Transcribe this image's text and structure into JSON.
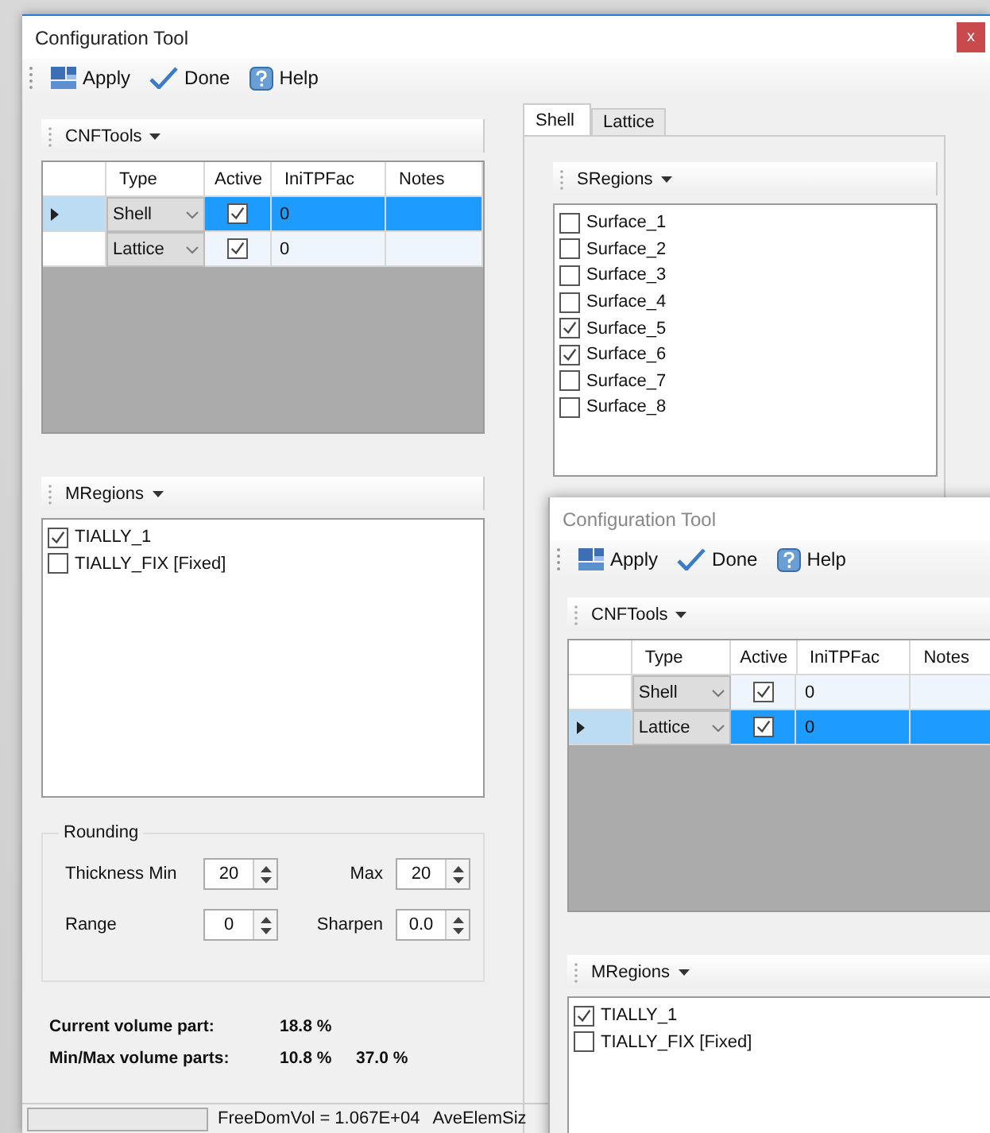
{
  "windows": [
    {
      "title": "Configuration Tool",
      "active": true,
      "close_button": "x",
      "toolbar": [
        {
          "kind": "apply",
          "label": "Apply"
        },
        {
          "kind": "done",
          "label": "Done"
        },
        {
          "kind": "help",
          "label": "Help"
        }
      ],
      "tool_grid": {
        "title": "CNFTools",
        "columns": [
          "Type",
          "Active",
          "IniTPFac",
          "Notes"
        ],
        "rows": [
          {
            "type": "Shell",
            "active": true,
            "initpfac": "0",
            "selected": true
          },
          {
            "type": "Lattice",
            "active": true,
            "initpfac": "0",
            "selected": false
          }
        ]
      },
      "mregions": {
        "title": "MRegions",
        "items": [
          {
            "label": "TIALLY_1",
            "checked": true
          },
          {
            "label": "TIALLY_FIX [Fixed]",
            "checked": false
          }
        ]
      },
      "rounding": {
        "title": "Rounding",
        "fields": [
          {
            "label": "Thickness Min",
            "value": "20"
          },
          {
            "label": "Max",
            "value": "20"
          },
          {
            "label": "Range",
            "value": "0"
          },
          {
            "label": "Sharpen",
            "value": "0.0"
          }
        ]
      },
      "volume": [
        {
          "label": "Current volume part:",
          "values": [
            "18.8 %"
          ]
        },
        {
          "label": "Min/Max volume parts:",
          "values": [
            "10.8 %",
            "37.0 %"
          ]
        }
      ],
      "tabs": [
        {
          "label": "Shell",
          "selected": true
        },
        {
          "label": "Lattice",
          "selected": false
        }
      ],
      "sregions": {
        "title": "SRegions",
        "items": [
          {
            "label": "Surface_1",
            "checked": false
          },
          {
            "label": "Surface_2",
            "checked": false
          },
          {
            "label": "Surface_3",
            "checked": false
          },
          {
            "label": "Surface_4",
            "checked": false
          },
          {
            "label": "Surface_5",
            "checked": true
          },
          {
            "label": "Surface_6",
            "checked": true
          },
          {
            "label": "Surface_7",
            "checked": false
          },
          {
            "label": "Surface_8",
            "checked": false
          }
        ]
      },
      "status_bar": [
        "FreeDomVol = 1.067E+04",
        "AveElemSiz"
      ]
    },
    {
      "title": "Configuration Tool",
      "active": false,
      "toolbar": [
        {
          "kind": "apply",
          "label": "Apply"
        },
        {
          "kind": "done",
          "label": "Done"
        },
        {
          "kind": "help",
          "label": "Help"
        }
      ],
      "tool_grid": {
        "title": "CNFTools",
        "columns": [
          "Type",
          "Active",
          "IniTPFac",
          "Notes"
        ],
        "rows": [
          {
            "type": "Shell",
            "active": true,
            "initpfac": "0",
            "selected": false
          },
          {
            "type": "Lattice",
            "active": true,
            "initpfac": "0",
            "selected": true
          }
        ]
      },
      "mregions": {
        "title": "MRegions",
        "items": [
          {
            "label": "TIALLY_1",
            "checked": true
          },
          {
            "label": "TIALLY_FIX [Fixed]",
            "checked": false
          }
        ]
      }
    }
  ]
}
